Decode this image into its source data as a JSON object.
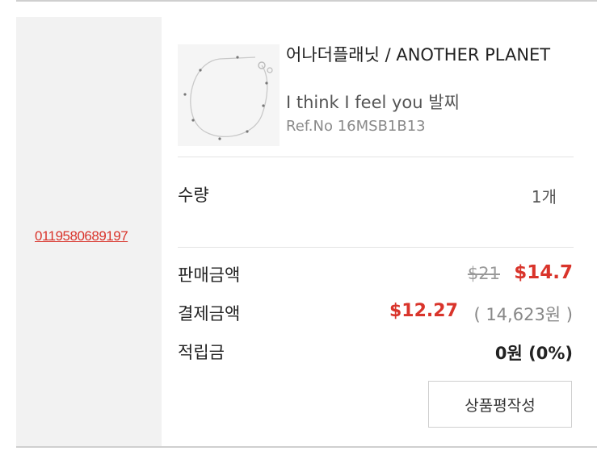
{
  "order": {
    "number": "0119580689197"
  },
  "product": {
    "brand": "어나더플래닛 / ANOTHER PLANET",
    "name": "I think I feel you 발찌",
    "ref": "Ref.No 16MSB1B13",
    "image": "anklet-chain-image"
  },
  "quantity": {
    "label": "수량",
    "value": "1개"
  },
  "price": {
    "sale_label": "판매금액",
    "original": "$21",
    "sale": "$14.7",
    "paid_label": "결제금액",
    "paid": "$12.27",
    "paid_krw": "( 14,623원 )",
    "points_label": "적립금",
    "points": "0원 (0%)"
  },
  "actions": {
    "review": "상품평작성"
  },
  "colors": {
    "accent": "#d9342b",
    "panel": "#f2f2f2"
  }
}
